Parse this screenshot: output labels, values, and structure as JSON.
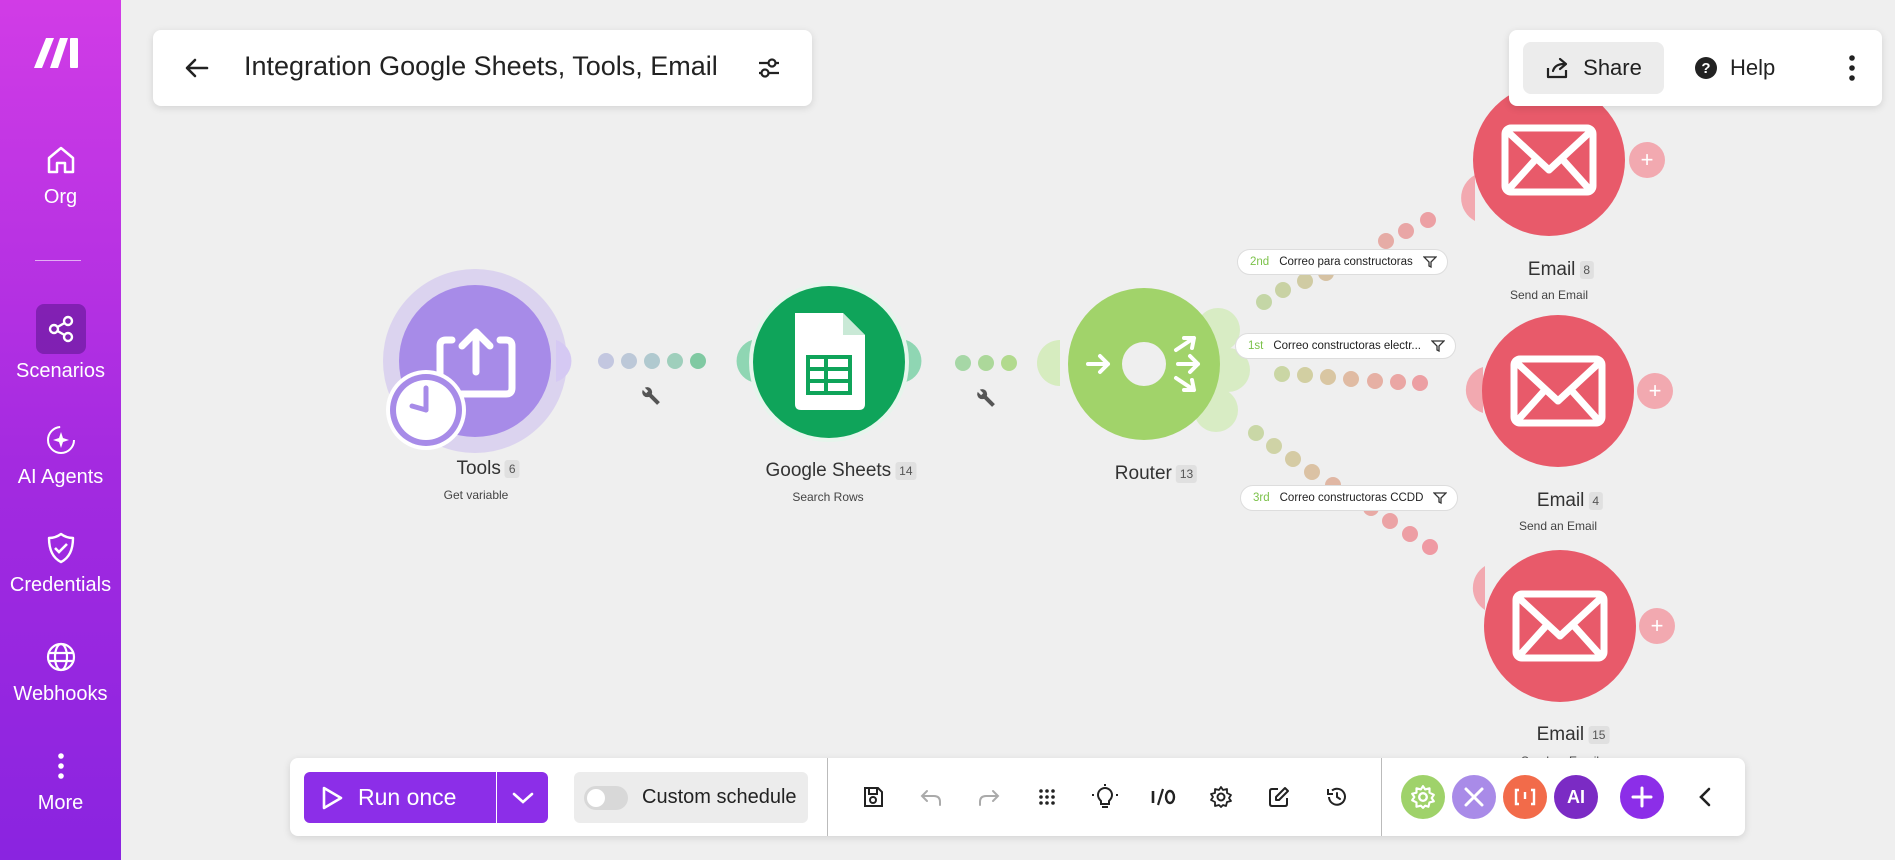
{
  "sidebar": {
    "logo": "make-logo",
    "items": [
      {
        "label": "Org",
        "icon": "home-icon"
      },
      {
        "label": "Scenarios",
        "icon": "share-nodes-icon"
      },
      {
        "label": "AI Agents",
        "icon": "ai-sparkle-icon"
      },
      {
        "label": "Credentials",
        "icon": "shield-check-icon"
      },
      {
        "label": "Webhooks",
        "icon": "globe-icon"
      },
      {
        "label": "More",
        "icon": "more-vertical-icon"
      }
    ]
  },
  "header": {
    "title": "Integration Google Sheets, Tools, Email"
  },
  "topright": {
    "share_label": "Share",
    "help_label": "Help"
  },
  "modules": [
    {
      "name": "Tools",
      "id": "6",
      "action": "Get variable",
      "color": "#a78be8"
    },
    {
      "name": "Google Sheets",
      "id": "14",
      "action": "Search Rows",
      "color": "#0fa45a"
    },
    {
      "name": "Router",
      "id": "13",
      "action": "",
      "color": "#a1d36a"
    },
    {
      "name": "Email",
      "id": "8",
      "action": "Send an Email",
      "color": "#e85a6a"
    },
    {
      "name": "Email",
      "id": "4",
      "action": "Send an Email",
      "color": "#e85a6a"
    },
    {
      "name": "Email",
      "id": "15",
      "action": "Send an Email",
      "color": "#e85a6a"
    }
  ],
  "filters": [
    {
      "order": "2nd",
      "label": "Correo para constructoras"
    },
    {
      "order": "1st",
      "label": "Correo constructoras electr..."
    },
    {
      "order": "3rd",
      "label": "Correo constructoras CCDD"
    }
  ],
  "toolbar": {
    "run_label": "Run once",
    "schedule_label": "Custom schedule",
    "ai_label": "AI",
    "accent": "#8c2ee8"
  }
}
